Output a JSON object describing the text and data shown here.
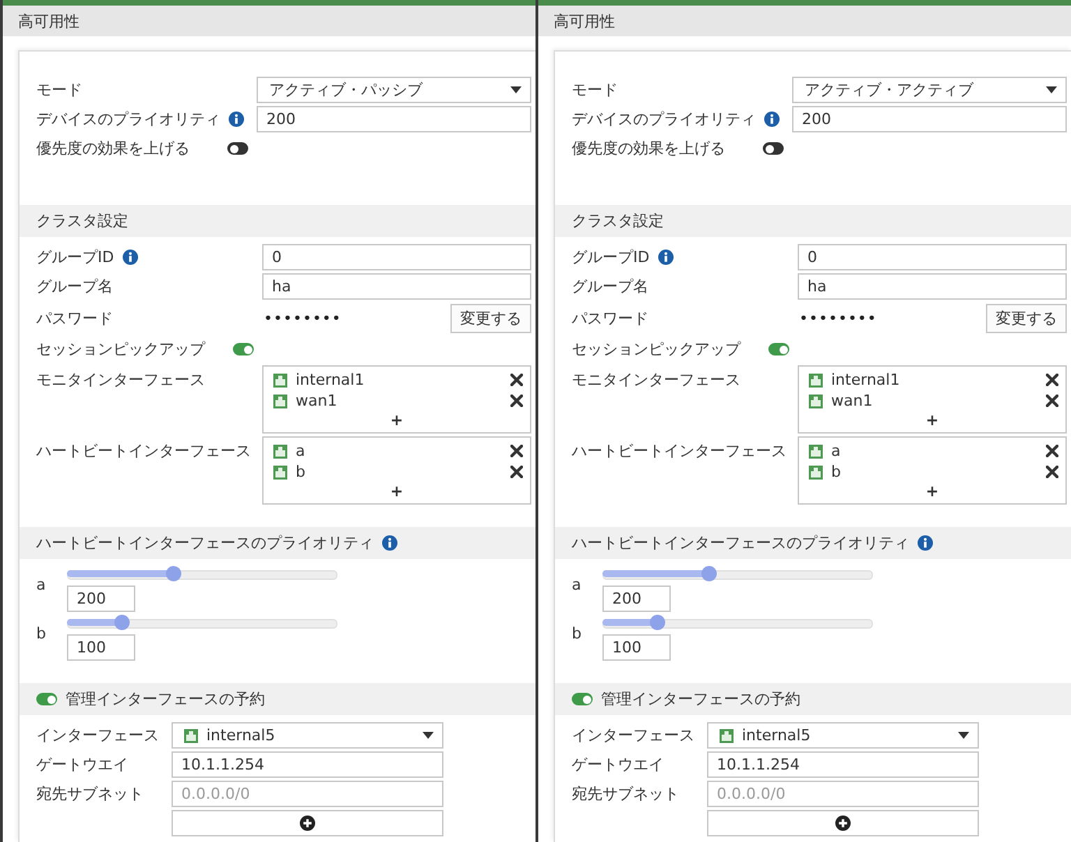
{
  "panels": [
    {
      "title": "高可用性",
      "fields": [
        {
          "kind": "select",
          "label": "モード",
          "value": "アクティブ・パッシブ"
        },
        {
          "kind": "input",
          "label": "デバイスのプライオリティ",
          "info": true,
          "value": "200"
        },
        {
          "kind": "toggle",
          "label": "優先度の効果を上げる",
          "on": false
        }
      ],
      "sections": [
        {
          "kind": "fields",
          "title": "クラスタ設定",
          "fields": [
            {
              "kind": "input",
              "label": "グループID",
              "info": true,
              "value": "0"
            },
            {
              "kind": "input",
              "label": "グループ名",
              "value": "ha"
            },
            {
              "kind": "password",
              "label": "パスワード",
              "value": "••••••••",
              "button": "変更する"
            },
            {
              "kind": "toggle",
              "label": "セッションピックアップ",
              "on": true
            },
            {
              "kind": "list",
              "label": "モニタインターフェース",
              "items": [
                "internal1",
                "wan1"
              ],
              "add": "+"
            },
            {
              "kind": "list",
              "label": "ハートビートインターフェース",
              "items": [
                "a",
                "b"
              ],
              "add": "+"
            }
          ]
        },
        {
          "kind": "sliders",
          "title": "ハートビートインターフェースのプライオリティ",
          "info": true,
          "sliders": [
            {
              "label": "a",
              "level": 0.39,
              "value": "200"
            },
            {
              "label": "b",
              "level": 0.2,
              "value": "100"
            }
          ]
        },
        {
          "kind": "fields",
          "title": "管理インターフェースの予約",
          "on": true,
          "fields": [
            {
              "kind": "port_select",
              "label": "インターフェース",
              "value": "internal5"
            },
            {
              "kind": "input",
              "label": "ゲートウエイ",
              "value": "10.1.1.254"
            },
            {
              "kind": "input",
              "label": "宛先サブネット",
              "placeholder": "0.0.0.0/0"
            },
            {
              "kind": "add_button"
            }
          ]
        }
      ]
    },
    {
      "title": "高可用性",
      "fields": [
        {
          "kind": "select",
          "label": "モード",
          "value": "アクティブ・アクティブ"
        },
        {
          "kind": "input",
          "label": "デバイスのプライオリティ",
          "info": true,
          "value": "200"
        },
        {
          "kind": "toggle",
          "label": "優先度の効果を上げる",
          "on": false
        }
      ],
      "sections": [
        {
          "kind": "fields",
          "title": "クラスタ設定",
          "fields": [
            {
              "kind": "input",
              "label": "グループID",
              "info": true,
              "value": "0"
            },
            {
              "kind": "input",
              "label": "グループ名",
              "value": "ha"
            },
            {
              "kind": "password",
              "label": "パスワード",
              "value": "••••••••",
              "button": "変更する"
            },
            {
              "kind": "toggle",
              "label": "セッションピックアップ",
              "on": true
            },
            {
              "kind": "list",
              "label": "モニタインターフェース",
              "items": [
                "internal1",
                "wan1"
              ],
              "add": "+"
            },
            {
              "kind": "list",
              "label": "ハートビートインターフェース",
              "items": [
                "a",
                "b"
              ],
              "add": "+"
            }
          ]
        },
        {
          "kind": "sliders",
          "title": "ハートビートインターフェースのプライオリティ",
          "info": true,
          "sliders": [
            {
              "label": "a",
              "level": 0.39,
              "value": "200"
            },
            {
              "label": "b",
              "level": 0.2,
              "value": "100"
            }
          ]
        },
        {
          "kind": "fields",
          "title": "管理インターフェースの予約",
          "on": true,
          "fields": [
            {
              "kind": "port_select",
              "label": "インターフェース",
              "value": "internal5"
            },
            {
              "kind": "input",
              "label": "ゲートウエイ",
              "value": "10.1.1.254"
            },
            {
              "kind": "input",
              "label": "宛先サブネット",
              "placeholder": "0.0.0.0/0"
            },
            {
              "kind": "add_button"
            }
          ]
        }
      ]
    }
  ]
}
